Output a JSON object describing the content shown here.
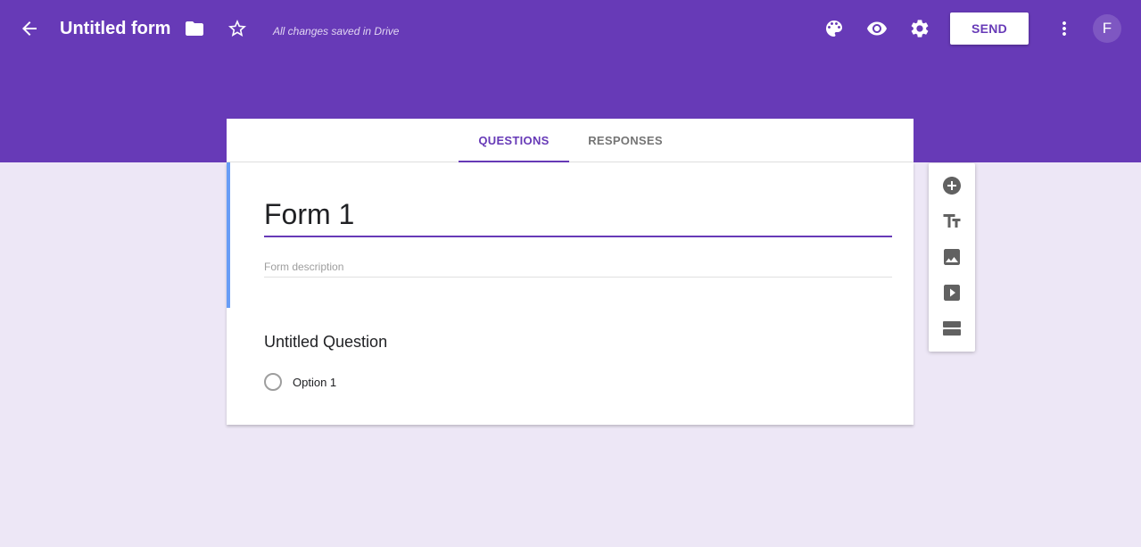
{
  "header": {
    "title": "Untitled form",
    "save_status": "All changes saved in Drive",
    "send_label": "SEND",
    "avatar_letter": "F",
    "icons": [
      "arrow-back-icon",
      "folder-icon",
      "star-outline-icon",
      "palette-icon",
      "eye-icon",
      "gear-icon",
      "more-vert-icon"
    ]
  },
  "tabs": [
    {
      "label": "QUESTIONS",
      "active": true
    },
    {
      "label": "RESPONSES",
      "active": false
    }
  ],
  "form": {
    "title": "Form 1",
    "description_placeholder": "Form description",
    "question": {
      "title": "Untitled Question",
      "options": [
        "Option 1"
      ]
    }
  },
  "toolbar": {
    "icons": [
      "add-circle-icon",
      "title-icon",
      "image-icon",
      "video-icon",
      "section-icon"
    ]
  },
  "colors": {
    "primary": "#673ab7",
    "background": "#ede7f6",
    "accent_bar": "#4285f4"
  }
}
